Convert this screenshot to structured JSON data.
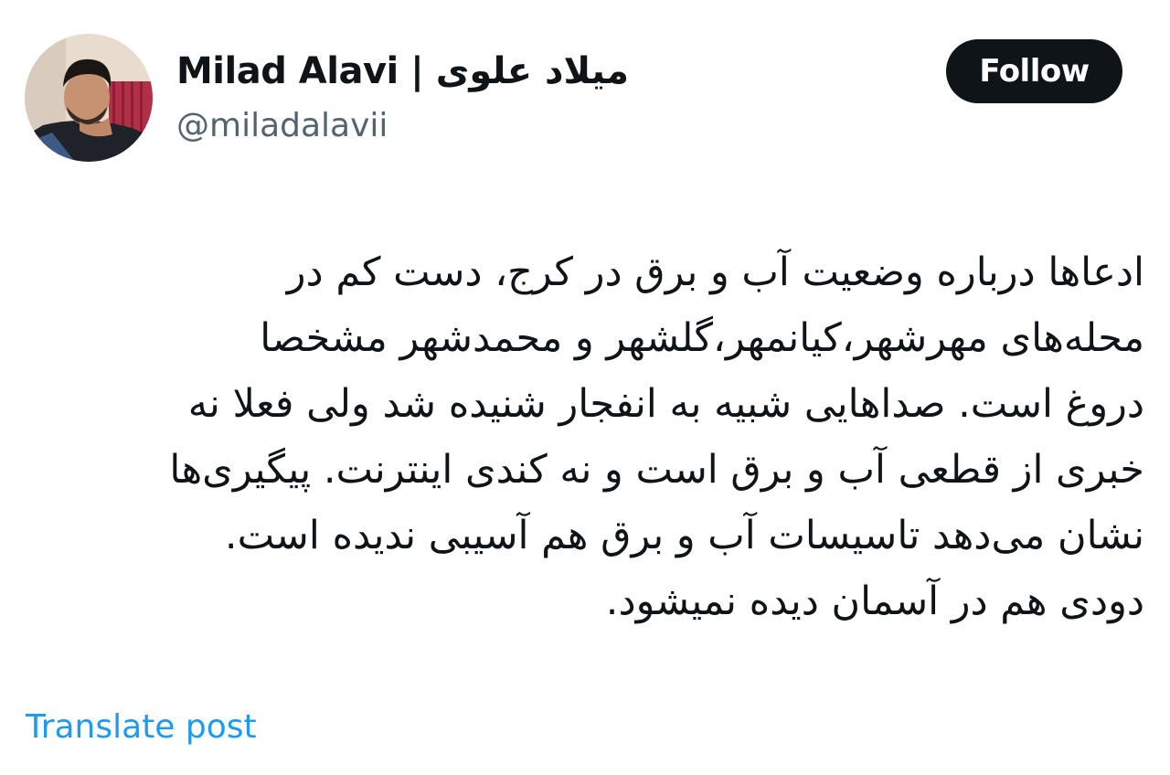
{
  "author": {
    "display_name": "Milad Alavi | میلاد علوی",
    "handle": "@miladalavii"
  },
  "follow_button": {
    "label": "Follow"
  },
  "post": {
    "lines": [
      "ادعاها درباره وضعیت آب و برق در کرج، دست کم در",
      "محله‌های مهرشهر،کیانمهر،گلشهر و محمدشهر مشخصا",
      "دروغ است. صداهایی شبیه به انفجار شنیده شد ولی فعلا نه",
      "خبری از قطعی آب و برق است و نه کندی اینترنت. پیگیری‌ها",
      "نشان می‌دهد تاسیسات آب و برق هم آسیبی ندیده است.",
      "دودی هم در آسمان دیده نمیشود."
    ]
  },
  "translate": {
    "label": "Translate post"
  },
  "colors": {
    "text_primary": "#0f1419",
    "text_secondary": "#536471",
    "link": "#1d9bf0",
    "button_bg": "#0f1419",
    "button_text": "#ffffff"
  }
}
